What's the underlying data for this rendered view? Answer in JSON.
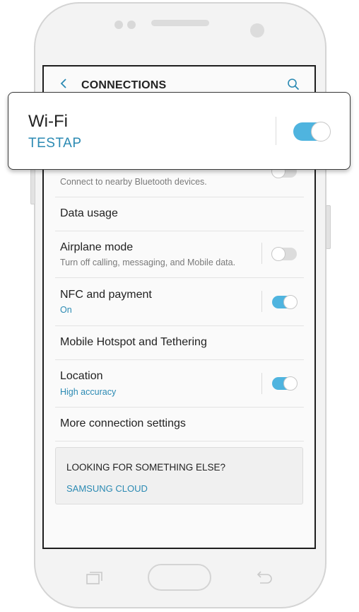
{
  "app_bar": {
    "title": "CONNECTIONS",
    "back_icon": "back-arrow-icon",
    "search_icon": "search-icon"
  },
  "callout": {
    "title": "Wi-Fi",
    "subtitle": "TESTAP",
    "toggle_on": true
  },
  "settings": {
    "bluetooth": {
      "subtitle": "Connect to nearby Bluetooth devices.",
      "toggle_on": false
    },
    "data_usage": {
      "title": "Data usage"
    },
    "airplane": {
      "title": "Airplane mode",
      "subtitle": "Turn off calling, messaging, and Mobile data.",
      "toggle_on": false
    },
    "nfc": {
      "title": "NFC and payment",
      "subtitle": "On",
      "toggle_on": true
    },
    "hotspot": {
      "title": "Mobile Hotspot and Tethering"
    },
    "location": {
      "title": "Location",
      "subtitle": "High accuracy",
      "toggle_on": true
    },
    "more": {
      "title": "More connection settings"
    }
  },
  "suggestion_card": {
    "title": "LOOKING FOR SOMETHING ELSE?",
    "link": "SAMSUNG CLOUD"
  },
  "colors": {
    "accent": "#2b8ab3",
    "toggle_on": "#4fb4df",
    "toggle_off": "#dcdcdc"
  }
}
